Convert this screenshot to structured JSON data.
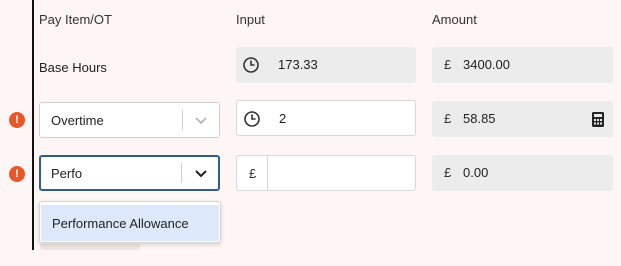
{
  "headers": {
    "pay_item": "Pay Item/OT",
    "input": "Input",
    "amount": "Amount"
  },
  "rows": [
    {
      "label": "Base Hours",
      "input_value": "173.33",
      "input_icon": "clock-icon",
      "currency": "£",
      "amount": "3400.00"
    },
    {
      "select_value": "Overtime",
      "warning_icon": "alert-icon",
      "input_value": "2",
      "input_icon": "clock-icon",
      "currency": "£",
      "amount": "58.85",
      "amount_icon": "calculator-icon"
    },
    {
      "select_value": "Perfo",
      "warning_icon": "alert-icon",
      "input_prefix": "£",
      "input_value": "",
      "currency": "£",
      "amount": "0.00"
    }
  ],
  "dropdown": {
    "options": [
      "Performance Allowance"
    ]
  },
  "colors": {
    "warning": "#e8572a",
    "focus_border": "#2f5d8f",
    "option_highlight": "#dde9fb",
    "background": "#fdf6f4"
  }
}
